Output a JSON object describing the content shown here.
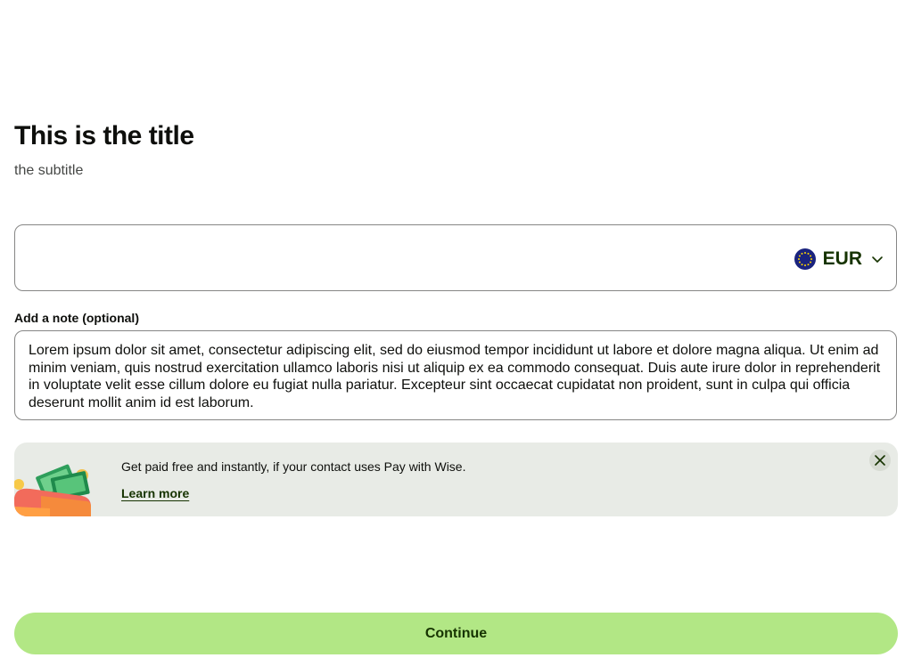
{
  "header": {
    "title": "This is the title",
    "subtitle": "the subtitle"
  },
  "amount": {
    "value": "",
    "currency_code": "EUR",
    "flag_icon": "eu-flag-icon",
    "dropdown_icon": "chevron-down-icon"
  },
  "note": {
    "label": "Add a note (optional)",
    "value": "Lorem ipsum dolor sit amet, consectetur adipiscing elit, sed do eiusmod tempor incididunt ut labore et dolore magna aliqua. Ut enim ad minim veniam, quis nostrud exercitation ullamco laboris nisi ut aliquip ex ea commodo consequat. Duis aute irure dolor in reprehenderit in voluptate velit esse cillum dolore eu fugiat nulla pariatur. Excepteur sint occaecat cupidatat non proident, sunt in culpa qui officia deserunt mollit anim id est laborum."
  },
  "promo": {
    "text": "Get paid free and instantly, if your contact uses Pay with Wise.",
    "link_label": "Learn more",
    "illustration_icon": "wallet-cash-illustration",
    "close_icon": "close-icon"
  },
  "footer": {
    "continue_label": "Continue"
  },
  "colors": {
    "accent": "#b2e785",
    "brand_text": "#163300",
    "promo_bg": "#e8ebe6",
    "border": "#868685"
  }
}
